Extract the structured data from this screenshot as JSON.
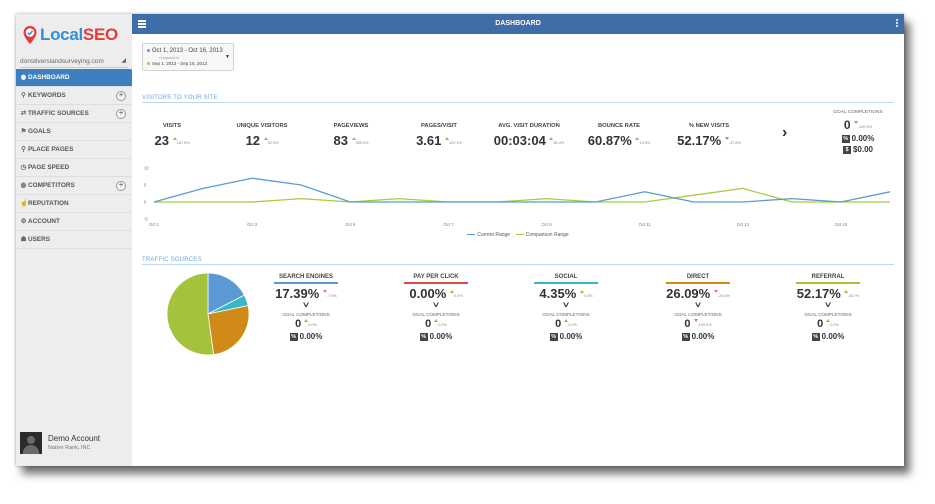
{
  "brand": {
    "local": "Local",
    "seo": "SEO"
  },
  "site_selector": {
    "value": "donstiverslandsurveying.com"
  },
  "nav": [
    {
      "label": "DASHBOARD",
      "icon": "dashboard-icon",
      "active": true,
      "expand": false
    },
    {
      "label": "KEYWORDS",
      "icon": "search-icon",
      "active": false,
      "expand": true
    },
    {
      "label": "TRAFFIC SOURCES",
      "icon": "shuffle-icon",
      "active": false,
      "expand": true
    },
    {
      "label": "GOALS",
      "icon": "flag-icon",
      "active": false,
      "expand": false
    },
    {
      "label": "PLACE PAGES",
      "icon": "map-pin-icon",
      "active": false,
      "expand": false
    },
    {
      "label": "PAGE SPEED",
      "icon": "clock-icon",
      "active": false,
      "expand": false
    },
    {
      "label": "COMPETITORS",
      "icon": "globe-icon",
      "active": false,
      "expand": true
    },
    {
      "label": "REPUTATION",
      "icon": "thumbs-up-icon",
      "active": false,
      "expand": false
    },
    {
      "label": "ACCOUNT",
      "icon": "gear-icon",
      "active": false,
      "expand": false
    },
    {
      "label": "USERS",
      "icon": "user-icon",
      "active": false,
      "expand": false
    }
  ],
  "account": {
    "name": "Demo Account",
    "company": "Native Rank, INC"
  },
  "header": {
    "title": "DASHBOARD"
  },
  "date_range": {
    "current": "Oct 1, 2013 - Oct 16, 2013",
    "compared_label": "Compared to",
    "comparison": "Sep 1, 2013 - Sep 16, 2013"
  },
  "visitors_section": {
    "title": "VISITORS TO YOUR SITE"
  },
  "metrics": [
    {
      "label": "VISITS",
      "value": "23",
      "change": "187.5%",
      "direction": "up"
    },
    {
      "label": "UNIQUE VISITORS",
      "value": "12",
      "change": "50.0%",
      "direction": "up"
    },
    {
      "label": "PAGEVIEWS",
      "value": "83",
      "change": "550.5%",
      "direction": "up"
    },
    {
      "label": "PAGES/VISIT",
      "value": "3.61",
      "change": "122.1%",
      "direction": "up"
    },
    {
      "label": "AVG. VISIT DURATION",
      "value": "00:03:04",
      "change": "65.4%",
      "direction": "up"
    },
    {
      "label": "BOUNCE RATE",
      "value": "60.87%",
      "change": "13.5%",
      "direction": "up"
    },
    {
      "label": "% NEW VISITS",
      "value": "52.17%",
      "change": "-47.8%",
      "direction": "down"
    }
  ],
  "goal_completions": {
    "title": "GOAL COMPLETIONS",
    "count": "0",
    "count_change": "-100.0%",
    "rate": "0.00%",
    "value": "$0.00",
    "rate_icon": "%",
    "value_icon": "$"
  },
  "chart_data": {
    "type": "line",
    "x": [
      "Oct 1",
      "Oct 2",
      "Oct 3",
      "Oct 4",
      "Oct 5",
      "Oct 6",
      "Oct 7",
      "Oct 8",
      "Oct 9",
      "Oct 10",
      "Oct 11",
      "Oct 12",
      "Oct 13",
      "Oct 14",
      "Oct 15",
      "Oct 16"
    ],
    "x_tick_labels": [
      "Oct 1",
      "Oct 3",
      "Oct 5",
      "Oct 7",
      "Oct 9",
      "Oct 11",
      "Oct 13",
      "Oct 15"
    ],
    "y_ticks": [
      "10",
      "5",
      "0",
      "-5"
    ],
    "ylim": [
      -5,
      10
    ],
    "series": [
      {
        "name": "Current Range",
        "color": "#5b9bd5",
        "values": [
          0,
          4,
          7,
          5,
          0,
          0,
          0,
          0,
          0,
          0,
          3,
          0,
          0,
          1,
          0,
          3
        ]
      },
      {
        "name": "Comparison Range",
        "color": "#a9cc3c",
        "values": [
          0,
          0,
          0,
          1,
          0,
          1,
          0,
          0,
          1,
          0,
          0,
          2,
          4,
          0,
          0,
          0
        ]
      }
    ]
  },
  "traffic_section": {
    "title": "TRAFFIC SOURCES"
  },
  "pie_data": {
    "type": "pie",
    "slices": [
      {
        "name": "Search Engines",
        "value": 17.39,
        "color": "#5b9bd5"
      },
      {
        "name": "Pay Per Click",
        "value": 0.0,
        "color": "#e04848"
      },
      {
        "name": "Social",
        "value": 4.35,
        "color": "#3bb6c4"
      },
      {
        "name": "Direct",
        "value": 26.09,
        "color": "#d08a17"
      },
      {
        "name": "Referral",
        "value": 52.17,
        "color": "#a4c23c"
      }
    ]
  },
  "sources": [
    {
      "label": "SEARCH ENGINES",
      "value": "17.39%",
      "change": "-7.6%",
      "direction": "down",
      "color": "#5b9bd5",
      "goal_title": "GOAL COMPLETIONS",
      "goal_count": "0",
      "goal_change": "0.0%",
      "goal_rate": "0.00%"
    },
    {
      "label": "PAY PER CLICK",
      "value": "0.00%",
      "change": "0.0%",
      "direction": "up",
      "color": "#e04848",
      "goal_title": "GOAL COMPLETIONS",
      "goal_count": "0",
      "goal_change": "0.0%",
      "goal_rate": "0.00%"
    },
    {
      "label": "SOCIAL",
      "value": "4.35%",
      "change": "4.3%",
      "direction": "up",
      "color": "#3bb6c4",
      "goal_title": "GOAL COMPLETIONS",
      "goal_count": "0",
      "goal_change": "0.0%",
      "goal_rate": "0.00%"
    },
    {
      "label": "DIRECT",
      "value": "26.09%",
      "change": "-28.6%",
      "direction": "down",
      "color": "#d08a17",
      "goal_title": "GOAL COMPLETIONS",
      "goal_count": "0",
      "goal_change": "-100.0%",
      "goal_rate": "0.00%"
    },
    {
      "label": "REFERRAL",
      "value": "52.17%",
      "change": "36.7%",
      "direction": "up",
      "color": "#a4c23c",
      "goal_title": "GOAL COMPLETIONS",
      "goal_count": "0",
      "goal_change": "0.0%",
      "goal_rate": "0.00%"
    }
  ]
}
